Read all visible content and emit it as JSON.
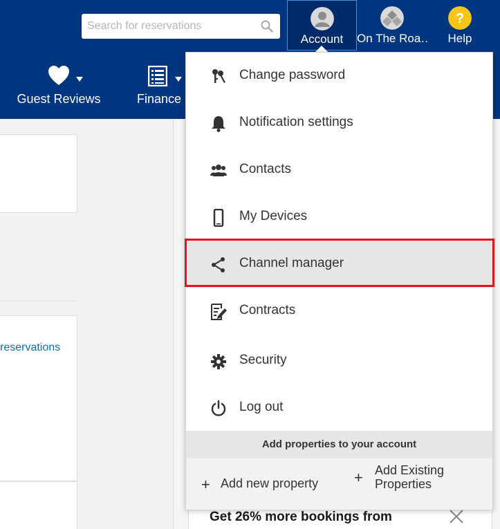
{
  "search": {
    "placeholder": "Search for reservations"
  },
  "topnav": {
    "account_label": "Account",
    "roads_label": "On The Roa…",
    "help_label": "Help"
  },
  "mainnav": {
    "guest_reviews": "Guest Reviews",
    "finance": "Finance"
  },
  "body": {
    "reservations_link": "reservations",
    "promo_title": "Get 26% more bookings from"
  },
  "account_menu": {
    "items": [
      {
        "label": "Change password",
        "icon": "keys-icon"
      },
      {
        "label": "Notification settings",
        "icon": "bell-icon"
      },
      {
        "label": "Contacts",
        "icon": "contacts-icon"
      },
      {
        "label": "My Devices",
        "icon": "phone-icon"
      },
      {
        "label": "Channel manager",
        "icon": "share-icon",
        "active": true
      },
      {
        "label": "Contracts",
        "icon": "contract-icon"
      },
      {
        "label": "Security",
        "icon": "gear-icon"
      },
      {
        "label": "Log out",
        "icon": "power-icon"
      }
    ],
    "add_header": "Add properties to your account",
    "add_new": "Add new property",
    "add_existing": "Add Existing Properties"
  },
  "colors": {
    "brand": "#003580",
    "help": "#f5c518",
    "highlight": "#e3101b",
    "link": "#0071c2"
  }
}
